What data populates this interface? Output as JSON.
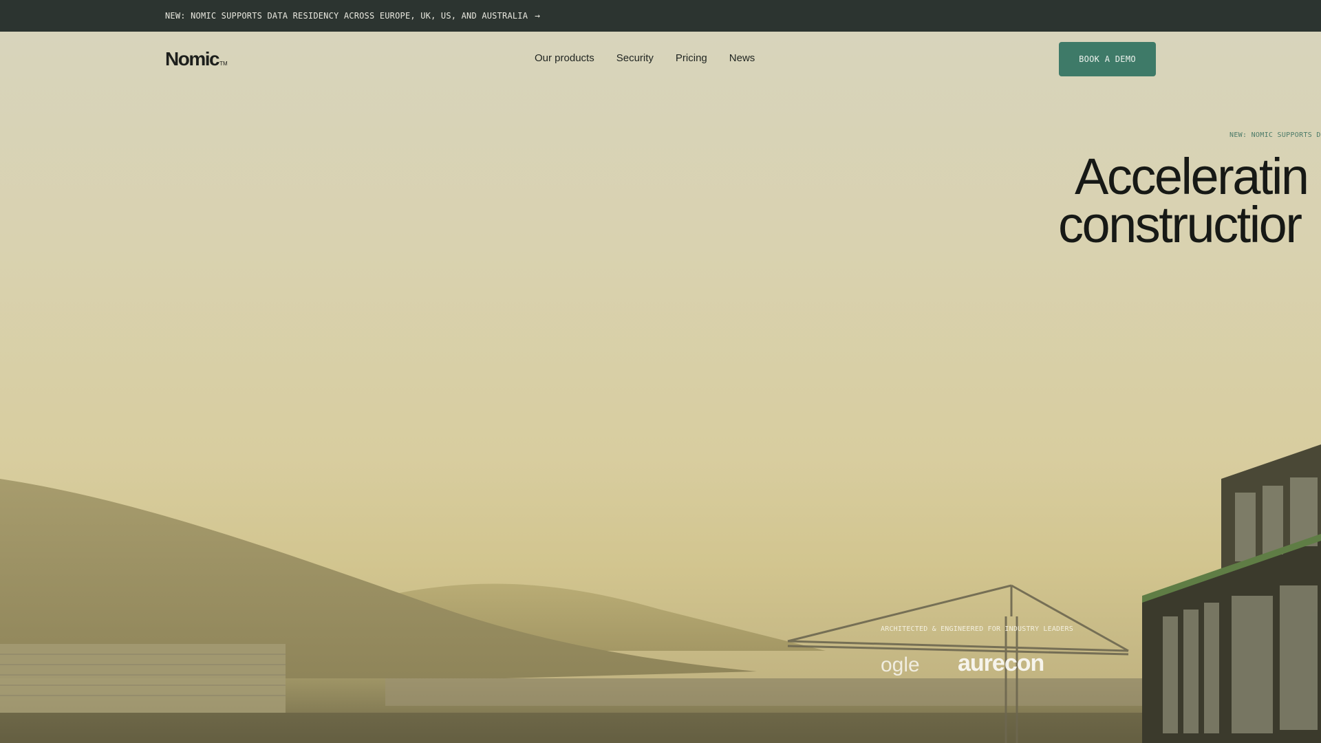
{
  "announcement": {
    "text": "NEW: NOMIC SUPPORTS DATA RESIDENCY ACROSS EUROPE, UK, US, AND AUSTRALIA",
    "arrow": "→"
  },
  "header": {
    "logo": "Nomic",
    "logo_mark": "TM",
    "nav": [
      "Our products",
      "Security",
      "Pricing",
      "News"
    ],
    "cta": "BOOK A DEMO"
  },
  "hero": {
    "tag": "NEW: NOMIC SUPPORTS DAT",
    "headline_line1": "Acceleratin",
    "headline_line2": "constructior",
    "industry_label": "ARCHITECTED & ENGINEERED FOR INDUSTRY LEADERS",
    "client_logos": [
      "ogle",
      "aurecon"
    ]
  },
  "colors": {
    "announce_bg": "#2c3430",
    "cta_bg": "#3e7a68",
    "hero_bg": "#d9d2b0"
  }
}
